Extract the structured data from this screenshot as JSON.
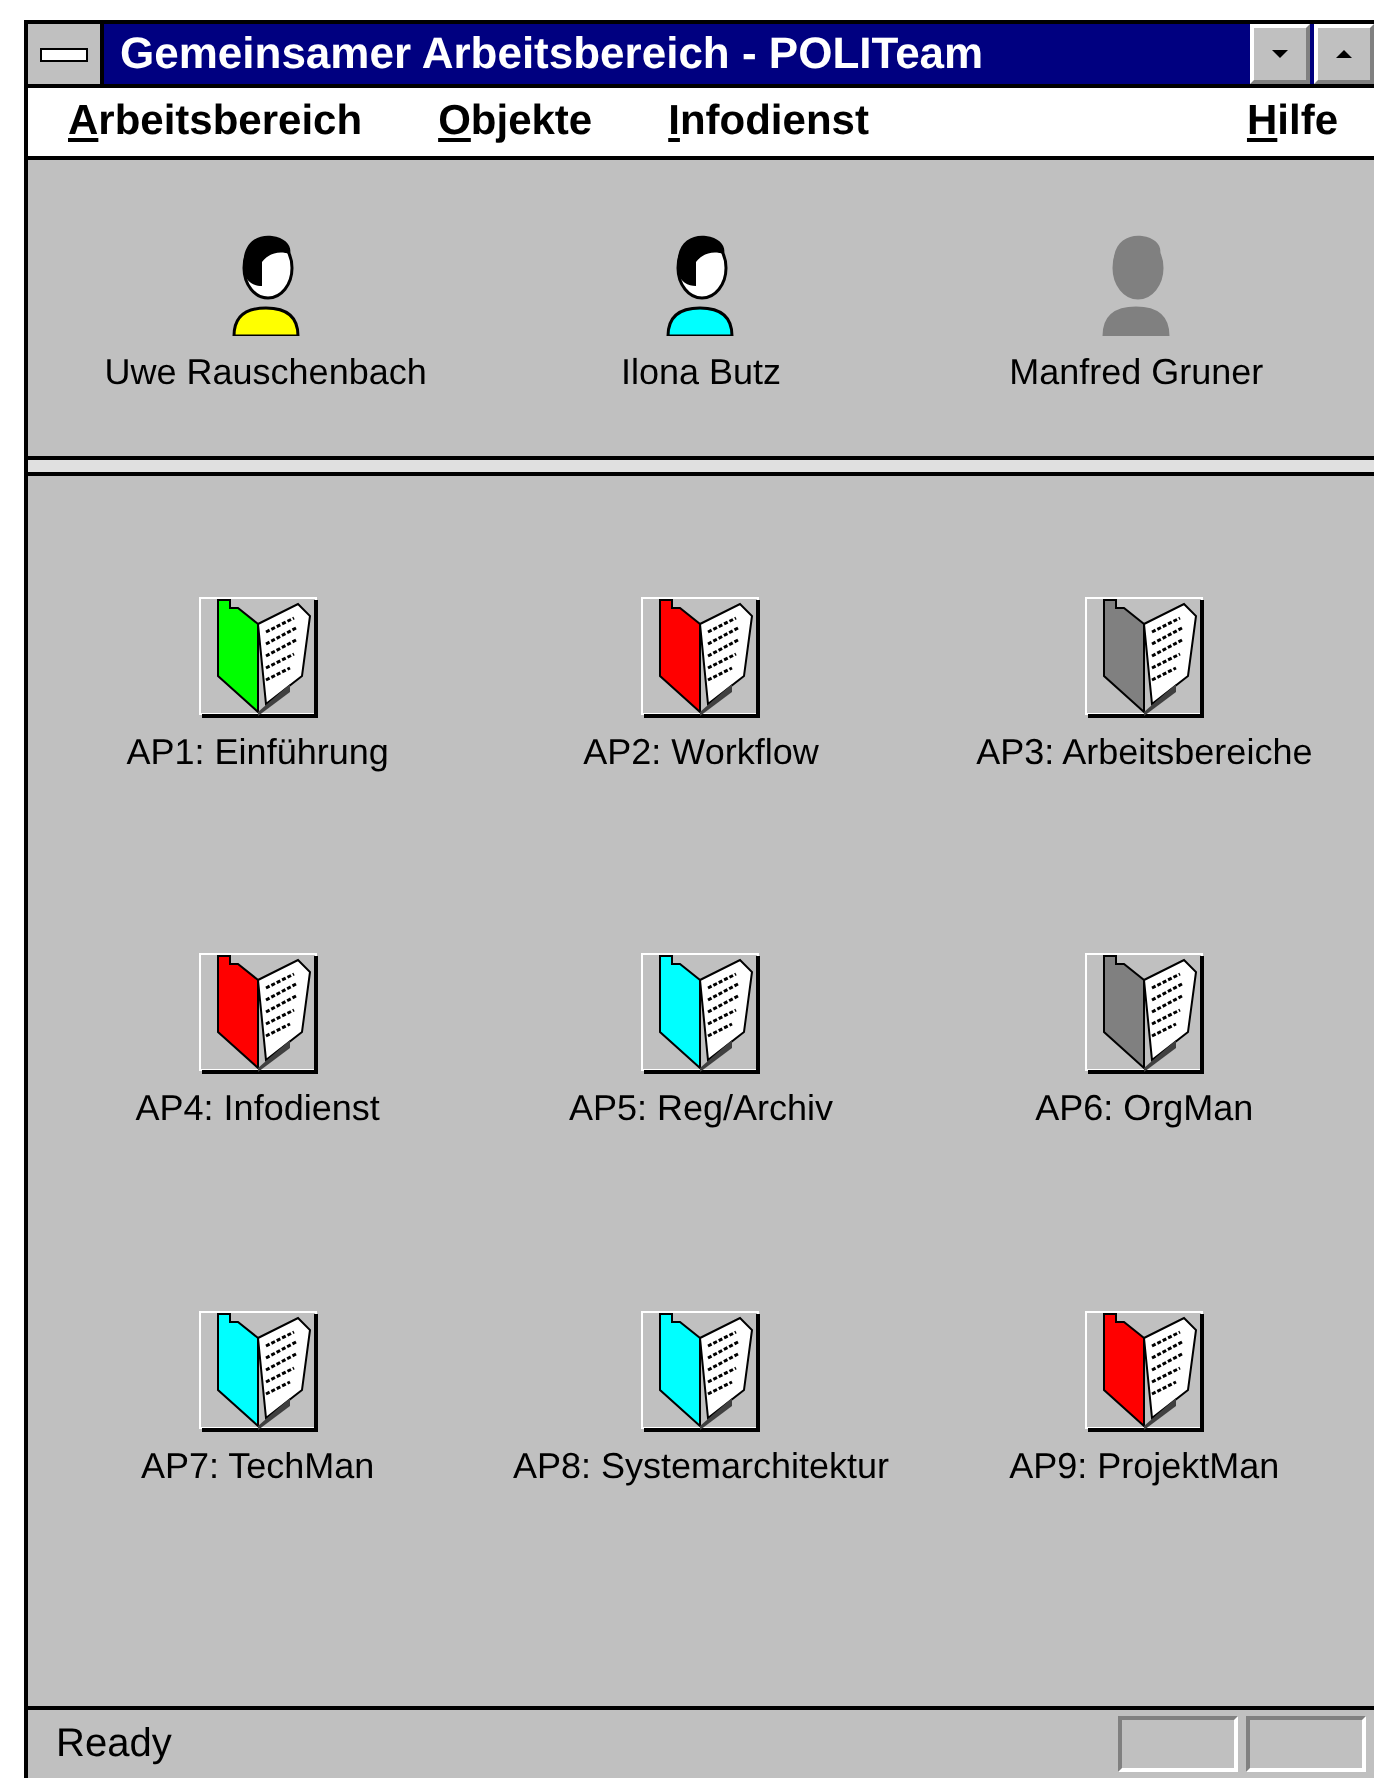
{
  "window": {
    "title": "Gemeinsamer Arbeitsbereich - POLITeam"
  },
  "menu": [
    {
      "label": "Arbeitsbereich"
    },
    {
      "label": "Objekte"
    },
    {
      "label": "Infodienst"
    },
    {
      "label": "Hilfe"
    }
  ],
  "members": [
    {
      "name": "Uwe Rauschenbach",
      "present": true,
      "color": "#ffff00"
    },
    {
      "name": "Ilona Butz",
      "present": true,
      "color": "#00ffff"
    },
    {
      "name": "Manfred Gruner",
      "present": false
    }
  ],
  "folders": [
    {
      "label": "AP1: Einführung",
      "color": "#00ff00"
    },
    {
      "label": "AP2: Workflow",
      "color": "#ff0000"
    },
    {
      "label": "AP3: Arbeitsbereiche",
      "color": "#808080"
    },
    {
      "label": "AP4: Infodienst",
      "color": "#ff0000"
    },
    {
      "label": "AP5: Reg/Archiv",
      "color": "#00ffff"
    },
    {
      "label": "AP6: OrgMan",
      "color": "#808080"
    },
    {
      "label": "AP7: TechMan",
      "color": "#00ffff"
    },
    {
      "label": "AP8: Systemarchitektur",
      "color": "#00ffff"
    },
    {
      "label": "AP9: ProjektMan",
      "color": "#ff0000"
    }
  ],
  "status_bar": {
    "text": "Ready"
  }
}
